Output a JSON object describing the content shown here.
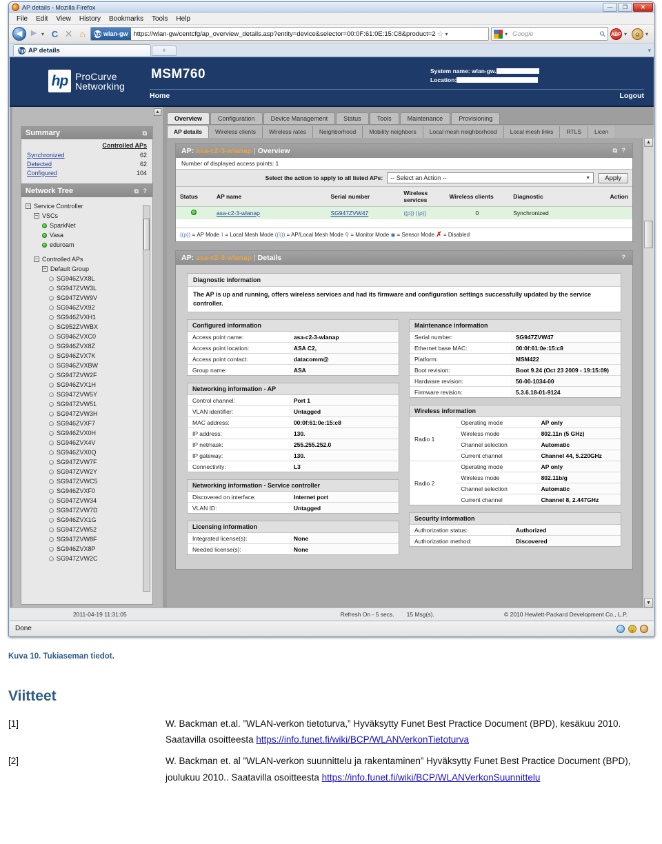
{
  "browser": {
    "window_title": "AP details - Mozilla Firefox",
    "window_buttons": {
      "minimize": "—",
      "maximize": "❐",
      "close": "✕"
    },
    "menu": [
      "File",
      "Edit",
      "View",
      "History",
      "Bookmarks",
      "Tools",
      "Help"
    ],
    "nav": {
      "back": "◀",
      "forward": "▶",
      "dropdown": "▾",
      "reload": "C",
      "stop": "✕",
      "home": "⌂"
    },
    "url_identity": "wlan-gw",
    "url": "https://wlan-gw/centcfg/ap_overview_details.asp?entity=device&selector=00:0F:61:0E:15:C8&product=2",
    "bookmark_star": "☆",
    "search_placeholder": "Google",
    "search_engine_label": "G",
    "addons": {
      "abp": "ABP",
      "identity": "☺"
    },
    "tab_title": "AP details",
    "new_tab": "+",
    "status_text": "Done"
  },
  "hp": {
    "logo_mark": "hp",
    "logo_line1": "ProCurve",
    "logo_line2": "Networking",
    "product": "MSM760",
    "system_name_label": "System name: wlan-gw.",
    "location_label": "Location:",
    "home": "Home",
    "logout": "Logout",
    "main_tabs": [
      {
        "label": "Overview",
        "active": true
      },
      {
        "label": "Configuration",
        "active": false
      },
      {
        "label": "Device Management",
        "active": false
      },
      {
        "label": "Status",
        "active": false
      },
      {
        "label": "Tools",
        "active": false
      },
      {
        "label": "Maintenance",
        "active": false
      },
      {
        "label": "Provisioning",
        "active": false
      }
    ],
    "sub_tabs": [
      {
        "label": "AP details",
        "active": true
      },
      {
        "label": "Wireless clients",
        "active": false
      },
      {
        "label": "Wireless rates",
        "active": false
      },
      {
        "label": "Neighborhood",
        "active": false
      },
      {
        "label": "Mobility neighbors",
        "active": false
      },
      {
        "label": "Local mesh neighborhood",
        "active": false
      },
      {
        "label": "Local mesh links",
        "active": false
      },
      {
        "label": "RTLS",
        "active": false
      },
      {
        "label": "Licen",
        "active": false
      }
    ]
  },
  "summary": {
    "title": "Summary",
    "column_header": "Controlled APs",
    "rows": [
      {
        "label": "Synchronized",
        "value": "62"
      },
      {
        "label": "Detected",
        "value": "62"
      },
      {
        "label": "Configured",
        "value": "104"
      }
    ]
  },
  "network_tree": {
    "title": "Network Tree",
    "root": "Service Controller",
    "vscs_group": "VSCs",
    "vscs": [
      "SparkNet",
      "Vasa",
      "eduroam"
    ],
    "controlled_aps_group": "Controlled APs",
    "default_group": "Default Group",
    "aps": [
      "SG946ZVX8L",
      "SG947ZVW3L",
      "SG947ZVW9V",
      "SG946ZVX92",
      "SG946ZVXH1",
      "SG952ZVWBX",
      "SG946ZVXC0",
      "SG946ZVX8Z",
      "SG946ZVX7K",
      "SG946ZVXBW",
      "SG947ZVW2F",
      "SG946ZVX1H",
      "SG947ZVW5Y",
      "SG947ZVW51",
      "SG947ZVW3H",
      "SG946ZVXF7",
      "SG946ZVX0H",
      "SG946ZVX4V",
      "SG946ZVX0Q",
      "SG947ZVW7F",
      "SG947ZVW2Y",
      "SG947ZVWC5",
      "SG946ZVXF0",
      "SG947ZVW34",
      "SG947ZVW7D",
      "SG946ZVX1G",
      "SG947ZVW52",
      "SG947ZVW8F",
      "SG946ZVX8P",
      "SG947ZVW2C"
    ]
  },
  "overview_panel": {
    "prefix": "AP:",
    "ap_name": "asa-c2-3-wlanap",
    "separator": "|",
    "section": "Overview",
    "count_text": "Number of displayed access points: 1",
    "action_label": "Select the action to apply to all listed APs:",
    "action_selected": "-- Select an Action --",
    "apply_button": "Apply",
    "columns": [
      "Status",
      "AP name",
      "Serial number",
      "Wireless services",
      "Wireless clients",
      "Diagnostic",
      "Action"
    ],
    "row": {
      "status": "online",
      "ap_name": "asa-c2-3-wlanap",
      "serial": "SG947ZVW47",
      "wireless_services": "((ρ)) ((ρ))",
      "wireless_clients": "0",
      "diagnostic": "Synchronized",
      "action": ""
    },
    "legend": [
      {
        "icon": "ap-mode",
        "text": "= AP Mode"
      },
      {
        "icon": "local-mesh-mode",
        "text": "= Local Mesh Mode"
      },
      {
        "icon": "ap-local-mesh-mode",
        "text": "= AP/Local Mesh Mode"
      },
      {
        "icon": "monitor-mode",
        "text": "= Monitor Mode"
      },
      {
        "icon": "sensor-mode",
        "text": "= Sensor Mode"
      },
      {
        "icon": "disabled",
        "text": "= Disabled"
      }
    ]
  },
  "details_panel": {
    "prefix": "AP:",
    "ap_name": "asa-c2-3-wlanap",
    "separator": "|",
    "section": "Details",
    "help": "?",
    "diagnostic_title": "Diagnostic information",
    "diagnostic_text": "The AP is up and running, offers wireless services and had its firmware and configuration settings successfully updated by the service controller.",
    "configured_information": {
      "title": "Configured information",
      "rows": [
        {
          "k": "Access point name:",
          "v": "asa-c2-3-wlanap"
        },
        {
          "k": "Access point location:",
          "v": "ASA C2,"
        },
        {
          "k": "Access point contact:",
          "v": "datacomm@"
        },
        {
          "k": "Group name:",
          "v": "ASA"
        }
      ]
    },
    "networking_ap": {
      "title": "Networking information - AP",
      "rows": [
        {
          "k": "Control channel:",
          "v": "Port 1"
        },
        {
          "k": "VLAN identifier:",
          "v": "Untagged"
        },
        {
          "k": "MAC address:",
          "v": "00:0f:61:0e:15:c8"
        },
        {
          "k": "IP address:",
          "v": "130."
        },
        {
          "k": "IP netmask:",
          "v": "255.255.252.0"
        },
        {
          "k": "IP gateway:",
          "v": "130."
        },
        {
          "k": "Connectivity:",
          "v": "L3"
        }
      ]
    },
    "networking_sc": {
      "title": "Networking information - Service controller",
      "rows": [
        {
          "k": "Discovered on interface:",
          "v": "Internet port"
        },
        {
          "k": "VLAN ID:",
          "v": "Untagged"
        }
      ]
    },
    "licensing": {
      "title": "Licensing information",
      "rows": [
        {
          "k": "Integrated license(s):",
          "v": "None"
        },
        {
          "k": "Needed license(s):",
          "v": "None"
        }
      ]
    },
    "maintenance": {
      "title": "Maintenance information",
      "rows": [
        {
          "k": "Serial number:",
          "v": "SG947ZVW47"
        },
        {
          "k": "Ethernet base MAC:",
          "v": "00:0f:61:0e:15:c8"
        },
        {
          "k": "Platform:",
          "v": "MSM422"
        },
        {
          "k": "Boot revision:",
          "v": "Boot 9.24 (Oct 23 2009 - 19:15:09)"
        },
        {
          "k": "Hardware revision:",
          "v": "50-00-1034-00"
        },
        {
          "k": "Firmware revision:",
          "v": "5.3.6.18-01-9124"
        }
      ]
    },
    "wireless": {
      "title": "Wireless information",
      "radios": [
        {
          "name": "Radio 1",
          "rows": [
            {
              "k": "Operating mode",
              "v": "AP only"
            },
            {
              "k": "Wireless mode",
              "v": "802.11n (5 GHz)"
            },
            {
              "k": "Channel selection",
              "v": "Automatic"
            },
            {
              "k": "Current channel",
              "v": "Channel 44, 5.220GHz"
            }
          ]
        },
        {
          "name": "Radio 2",
          "rows": [
            {
              "k": "Operating mode",
              "v": "AP only"
            },
            {
              "k": "Wireless mode",
              "v": "802.11b/g"
            },
            {
              "k": "Channel selection",
              "v": "Automatic"
            },
            {
              "k": "Current channel",
              "v": "Channel 8, 2.447GHz"
            }
          ]
        }
      ]
    },
    "security": {
      "title": "Security information",
      "rows": [
        {
          "k": "Authorization status:",
          "v": "Authorized"
        },
        {
          "k": "Authorization method:",
          "v": "Discovered"
        }
      ]
    }
  },
  "page_footer": {
    "timestamp": "2011-04-19 11:31:05",
    "refresh": "Refresh On - 5 secs.",
    "messages": "15 Msg(s).",
    "copyright": "© 2010 Hewlett-Packard Development Co., L.P."
  },
  "document": {
    "caption": "Kuva 10. Tukiaseman tiedot.",
    "references_heading": "Viitteet",
    "references": [
      {
        "num": "[1]",
        "text": "W. Backman et.al. ”WLAN-verkon tietoturva,” Hyväksytty Funet Best Practice Document (BPD), kesäkuu 2010. Saatavilla osoitteesta",
        "link": "https://info.funet.fi/wiki/BCP/WLANVerkonTietoturva"
      },
      {
        "num": "[2]",
        "text": "W. Backman et. al ”WLAN-verkon suunnittelu ja rakentaminen” Hyväksytty Funet Best Practice Document (BPD), joulukuu 2010.. Saatavilla osoitteesta",
        "link": "https://info.funet.fi/wiki/BCP/WLANVerkonSuunnittelu"
      }
    ]
  },
  "colors": {
    "hp_header_blue": "#1d3a68",
    "accent_orange": "#e8a44a",
    "row_green": "#dff3df",
    "doc_heading_blue": "#2e5c8a",
    "link_blue": "#1a13c8"
  }
}
